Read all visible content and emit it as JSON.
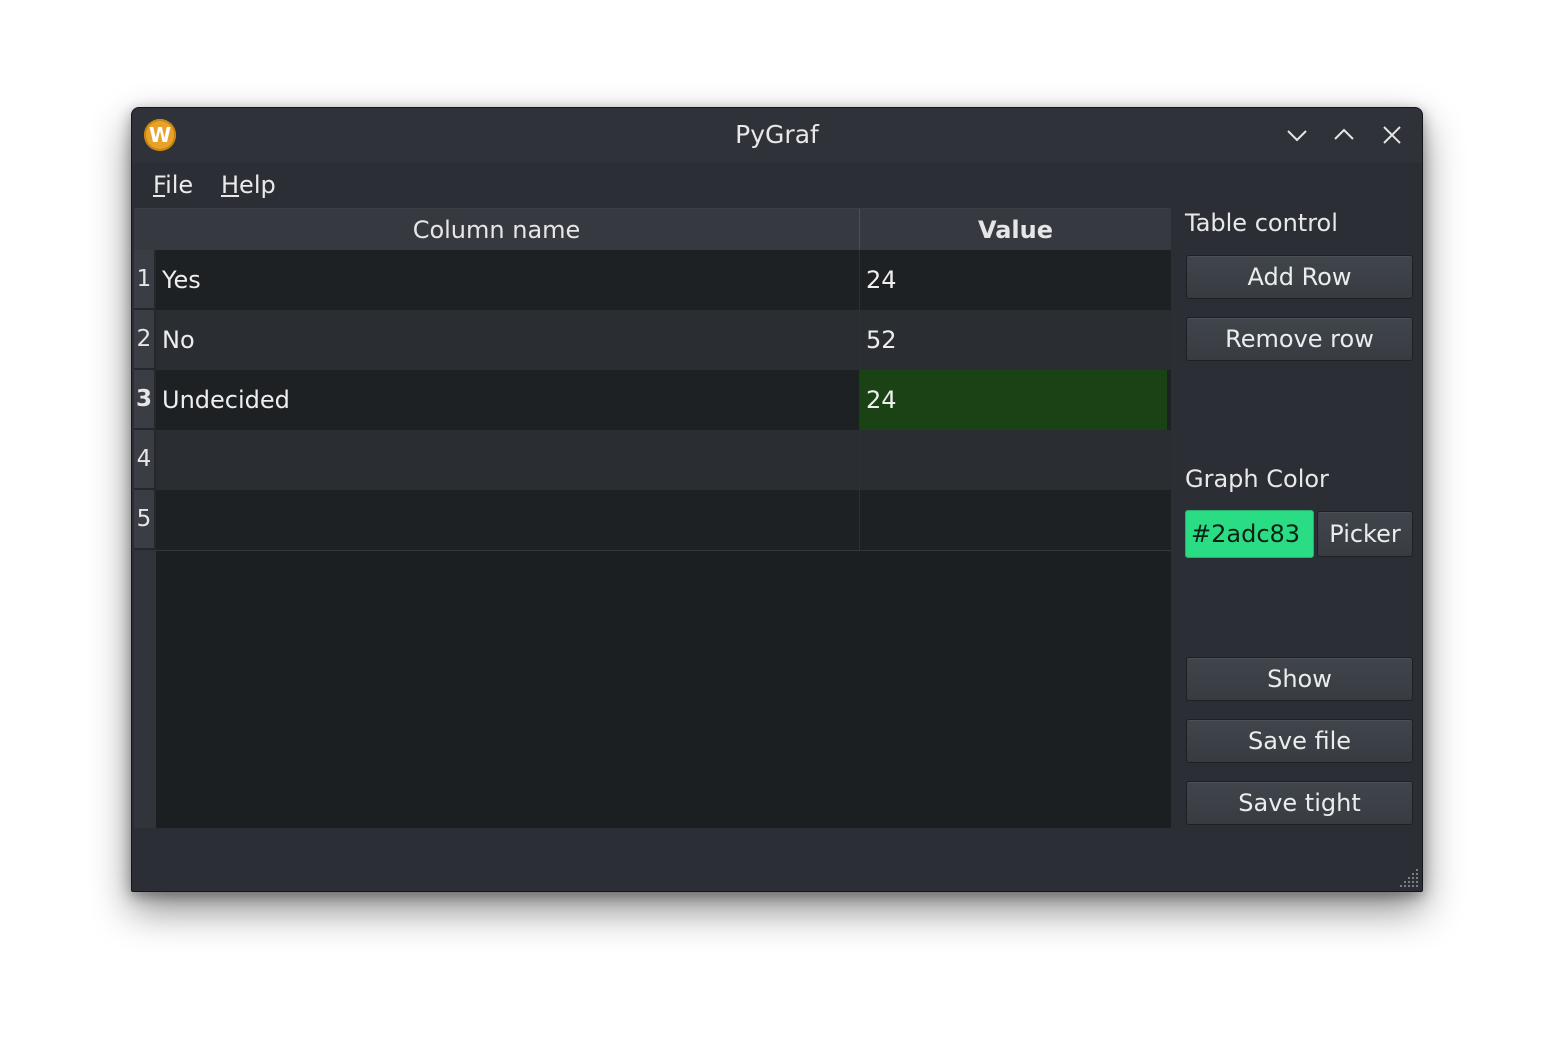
{
  "window": {
    "title": "PyGraf",
    "app_icon_letter": "W"
  },
  "menu": {
    "items": [
      {
        "label": "File",
        "mnemonic": "F",
        "rest": "ile"
      },
      {
        "label": "Help",
        "mnemonic": "H",
        "rest": "elp"
      }
    ]
  },
  "table": {
    "headers": [
      "Column name",
      "Value"
    ],
    "row_numbers": [
      "1",
      "2",
      "3",
      "4",
      "5"
    ],
    "rows": [
      {
        "name": "Yes",
        "value": "24"
      },
      {
        "name": "No",
        "value": "52"
      },
      {
        "name": "Undecided",
        "value": "24"
      },
      {
        "name": "",
        "value": ""
      },
      {
        "name": "",
        "value": ""
      }
    ],
    "selected_row": 3
  },
  "panel": {
    "table_control_label": "Table control",
    "add_row_label": "Add Row",
    "remove_row_label": "Remove row",
    "graph_color_label": "Graph Color",
    "graph_color_value": "#2adc83",
    "picker_label": "Picker",
    "show_label": "Show",
    "save_file_label": "Save file",
    "save_tight_label": "Save tight"
  },
  "colors": {
    "window_bg": "#2b2f35",
    "table_bg": "#1c1f22",
    "selected_cell": "#1b4214",
    "graph_color": "#2adc83",
    "app_icon": "#e8a22a"
  }
}
